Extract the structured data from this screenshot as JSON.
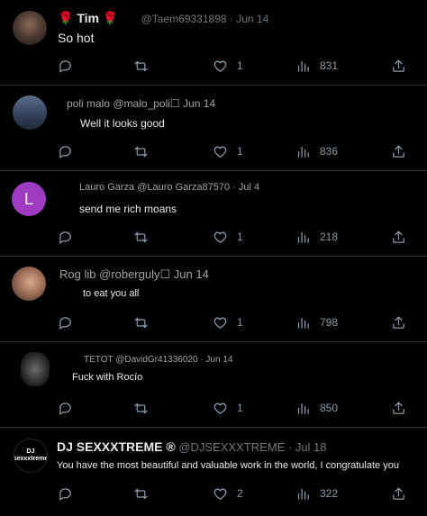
{
  "colors": {
    "background": "#000000",
    "text": "#e7e9ea",
    "muted": "#71767b",
    "icon": "#8b98a5",
    "divider": "#2f3336",
    "avatar_purple": "#a03cc4"
  },
  "replies": [
    {
      "name": "🌹 Tim 🌹",
      "handle": "@Taem69331898",
      "date": "· Jun 14",
      "text": "So hot",
      "likes": "1",
      "views": "831",
      "avatar_letter": ""
    },
    {
      "name": "poli malo",
      "handle": "@malo_poli☐",
      "date": "Jun 14",
      "text": "Well it looks good",
      "likes": "1",
      "views": "836",
      "avatar_letter": ""
    },
    {
      "name": "Lauro Garza",
      "handle": "@Lauro Garza87570",
      "date": "· Jul 4",
      "text": "send me rich moans",
      "likes": "1",
      "views": "218",
      "avatar_letter": "L"
    },
    {
      "name": "Rog lib",
      "handle": "@roberguly☐",
      "date": "Jun 14",
      "text": "to eat you all",
      "likes": "1",
      "views": "798",
      "avatar_letter": ""
    },
    {
      "name": "TETOT",
      "handle": "@DavidGr41336020",
      "date": "· Jun 14",
      "text": "Fuck with Rocío",
      "likes": "1",
      "views": "850",
      "avatar_letter": ""
    },
    {
      "name": "DJ SEXXXTREME ®",
      "handle": "@DJSEXXXTREME",
      "date": "· Jul 18",
      "text": "You have the most beautiful and valuable work in the world, I congratulate you",
      "likes": "2",
      "views": "322",
      "avatar_letter": "DJ\nsexxxtreme"
    }
  ],
  "icons": {
    "reply": "reply-bubble-icon",
    "retweet": "retweet-icon",
    "like": "heart-icon",
    "views": "views-bar-chart-icon",
    "share": "share-upload-icon"
  }
}
